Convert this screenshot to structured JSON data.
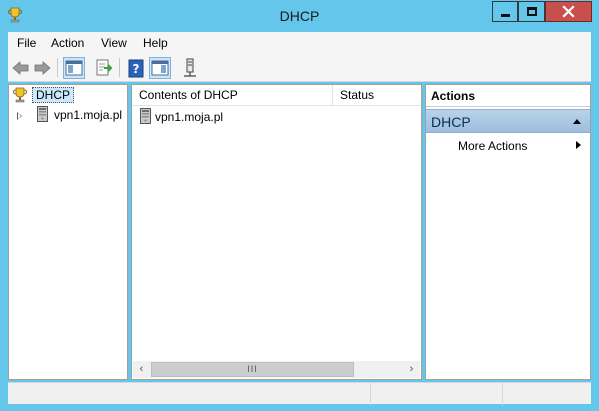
{
  "window": {
    "title": "DHCP",
    "controls": [
      "minimize",
      "maximize",
      "close"
    ]
  },
  "menubar": {
    "items": [
      {
        "label": "File"
      },
      {
        "label": "Action"
      },
      {
        "label": "View"
      },
      {
        "label": "Help"
      }
    ]
  },
  "toolbar": {
    "buttons": [
      {
        "icon": "back-arrow-icon"
      },
      {
        "icon": "forward-arrow-icon"
      },
      {
        "icon": "show-hide-console-tree-icon"
      },
      {
        "icon": "export-list-icon"
      },
      {
        "icon": "help-icon"
      },
      {
        "icon": "show-hide-action-pane-icon"
      },
      {
        "icon": "connect-server-icon"
      }
    ]
  },
  "tree": {
    "root": {
      "label": "DHCP",
      "icon": "dhcp-trophy-icon",
      "selected": true
    },
    "children": [
      {
        "label": "vpn1.moja.pl",
        "icon": "server-icon",
        "expandable": true
      }
    ]
  },
  "list": {
    "columns": [
      "Contents of DHCP",
      "Status"
    ],
    "rows": [
      {
        "name": "vpn1.moja.pl",
        "status": "",
        "icon": "server-icon"
      }
    ],
    "scrollbar_thumb_text": "III"
  },
  "actions": {
    "title": "Actions",
    "group": "DHCP",
    "items": [
      {
        "label": "More Actions",
        "has_submenu": true
      }
    ]
  },
  "statusbar": {
    "cells": [
      "",
      "",
      ""
    ]
  },
  "colors": {
    "frame": "#63c6ea",
    "close_button": "#c7504c",
    "actions_group": "#a9c8e4",
    "selection": "#cce8ff"
  }
}
